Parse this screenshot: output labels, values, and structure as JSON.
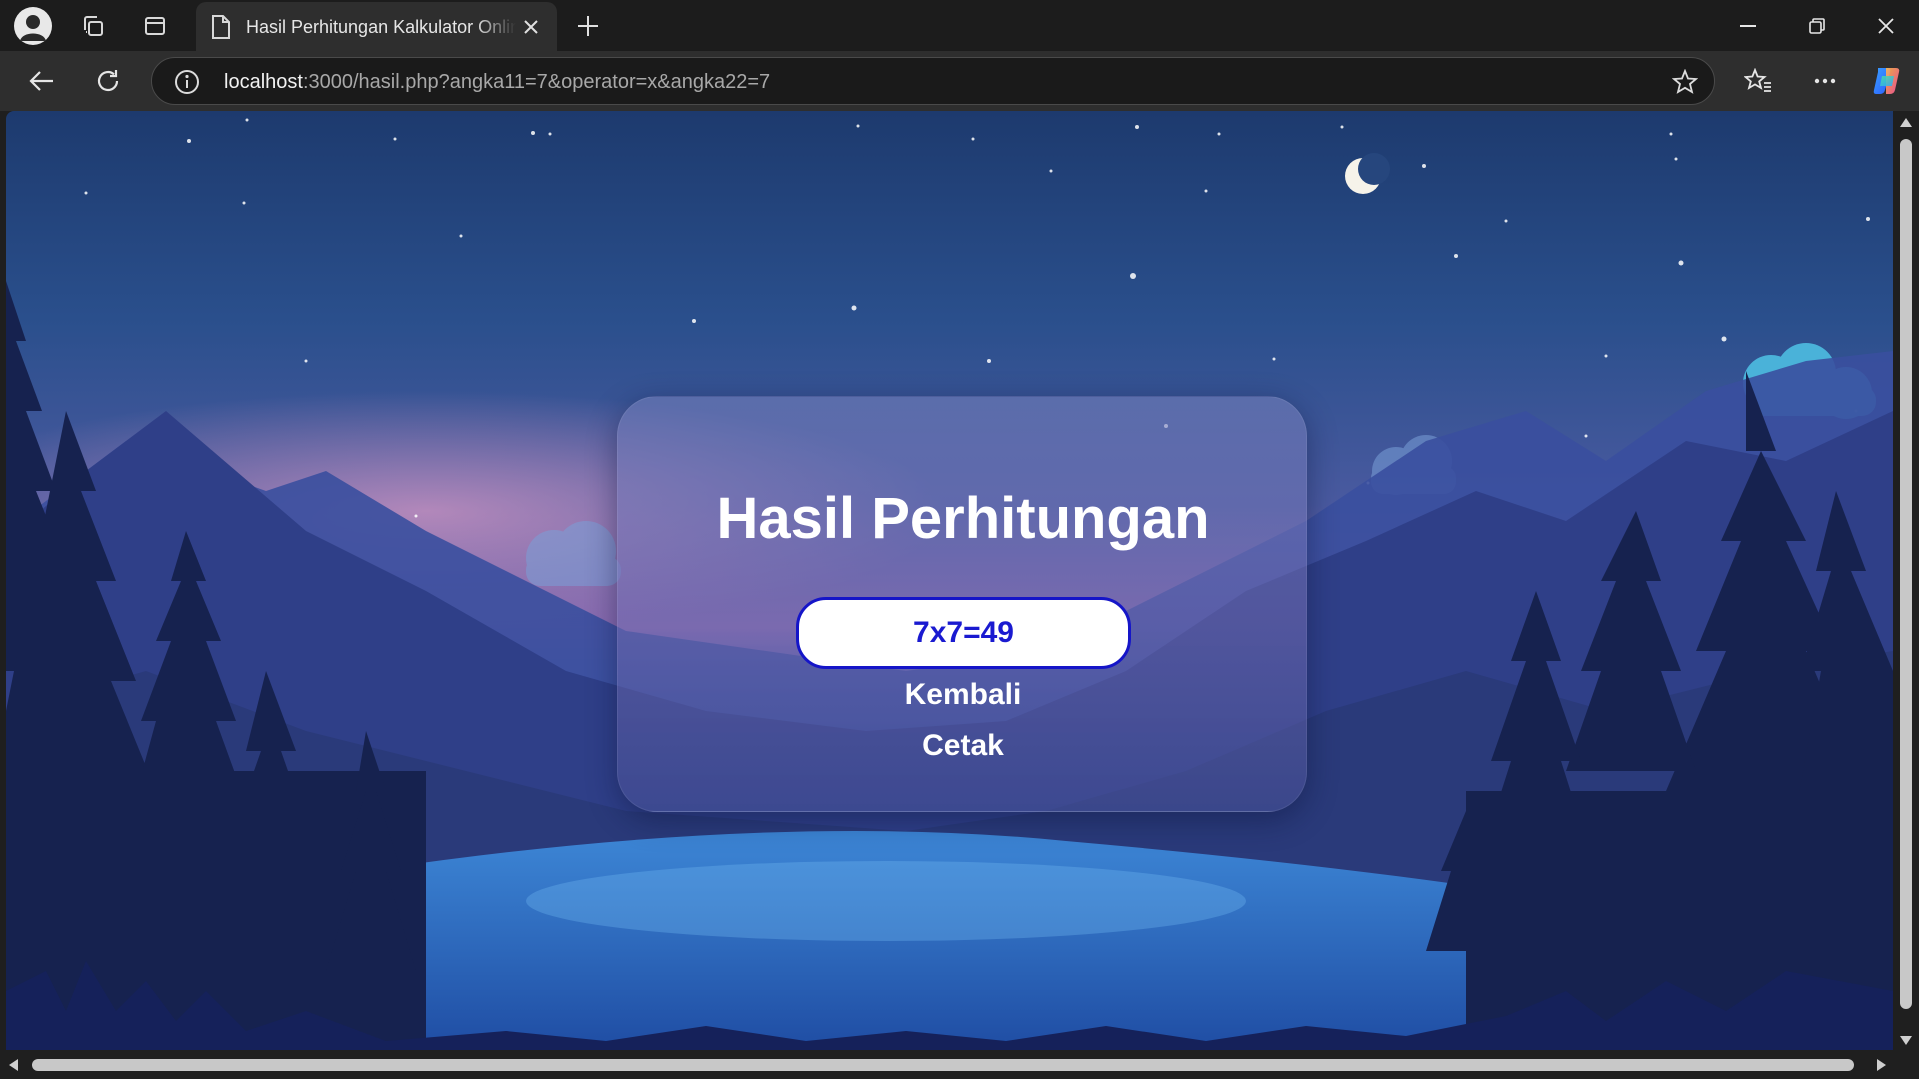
{
  "browser": {
    "tab": {
      "title": "Hasil Perhitungan Kalkulator Online"
    },
    "address_bar": {
      "host": "localhost",
      "path": ":3000/hasil.php?angka11=7&operator=x&angka22=7"
    }
  },
  "page": {
    "title": "Hasil Perhitungan",
    "result": "7x7=49",
    "back_link": "Kembali",
    "print_link": "Cetak"
  },
  "colors": {
    "result_text": "#1a1ad0",
    "result_border": "#1515c8",
    "title_text": "#ffffff"
  }
}
